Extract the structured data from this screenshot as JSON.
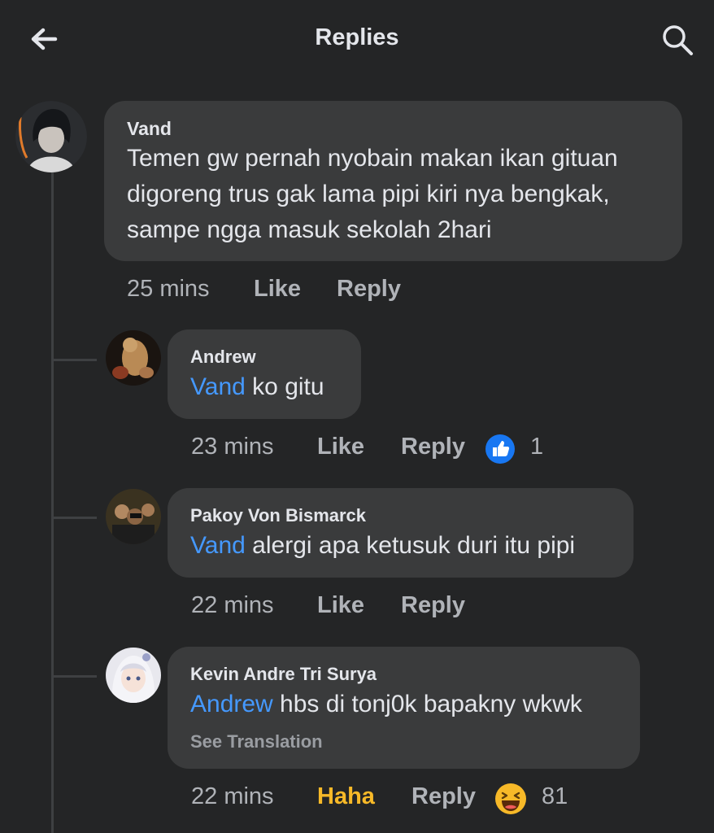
{
  "header": {
    "title": "Replies"
  },
  "comments": [
    {
      "author": "Vand",
      "text_lines": [
        "Temen gw pernah nyobain makan ikan gituan",
        "digoreng trus gak lama pipi kiri nya bengkak,",
        "sampe ngga masuk sekolah 2hari"
      ],
      "time": "25 mins",
      "like_label": "Like",
      "reply_label": "Reply"
    },
    {
      "author": "Andrew",
      "mention": "Vand",
      "text": " ko gitu",
      "time": "23 mins",
      "like_label": "Like",
      "reply_label": "Reply",
      "reaction": {
        "icon": "like-reaction-icon",
        "count": "1"
      }
    },
    {
      "author": "Pakoy Von Bismarck",
      "mention": "Vand",
      "text": " alergi apa ketusuk duri itu pipi",
      "time": "22 mins",
      "like_label": "Like",
      "reply_label": "Reply"
    },
    {
      "author": "Kevin Andre Tri Surya",
      "mention": "Andrew",
      "text": " hbs di tonj0k bapakny wkwk",
      "see_translation": "See Translation",
      "time": "22 mins",
      "like_label": "Haha",
      "reply_label": "Reply",
      "reaction": {
        "icon": "haha-reaction-icon",
        "count": "81"
      }
    }
  ],
  "colors": {
    "background": "#242526",
    "bubble": "#3a3b3c",
    "mention": "#4599ff",
    "like_reaction": "#1877f2",
    "haha": "#f7b928"
  }
}
